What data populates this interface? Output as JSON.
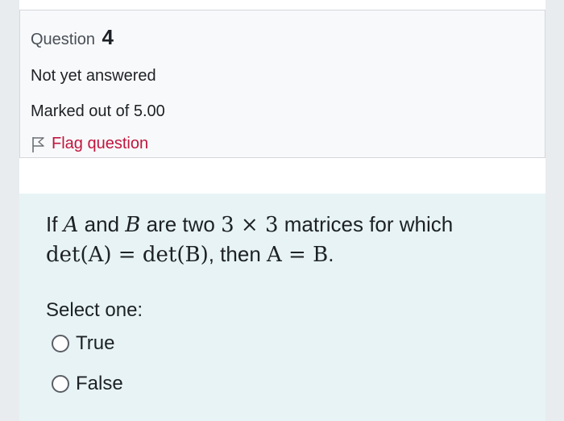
{
  "info": {
    "question_label": "Question",
    "question_number": "4",
    "state": "Not yet answered",
    "grade": "Marked out of 5.00",
    "flag_label": "Flag question"
  },
  "question": {
    "line1": {
      "t1": "If ",
      "A": "A",
      "t2": " and ",
      "B": "B",
      "t3": " are two ",
      "dims": "3 × 3",
      "t4": " matrices for which"
    },
    "line2": {
      "lhs": "det(A) = det(B)",
      "t5": ", then ",
      "eq": "A = B",
      "t6": "."
    },
    "prompt": "Select one:",
    "options": [
      {
        "label": "True"
      },
      {
        "label": "False"
      }
    ]
  },
  "colors": {
    "flag_link": "#c0163e",
    "content_bg": "#e7f3f5",
    "info_bg": "#f8f9fa"
  }
}
